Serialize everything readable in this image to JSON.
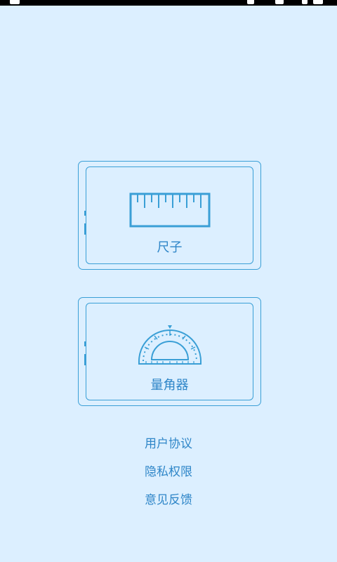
{
  "cards": {
    "ruler": {
      "label": "尺子"
    },
    "protractor": {
      "label": "量角器"
    }
  },
  "links": {
    "user_agreement": "用户协议",
    "privacy_permissions": "隐私权限",
    "feedback": "意见反馈"
  },
  "colors": {
    "background": "#dcefff",
    "accent": "#3a9fd6",
    "text": "#2f86c8"
  }
}
